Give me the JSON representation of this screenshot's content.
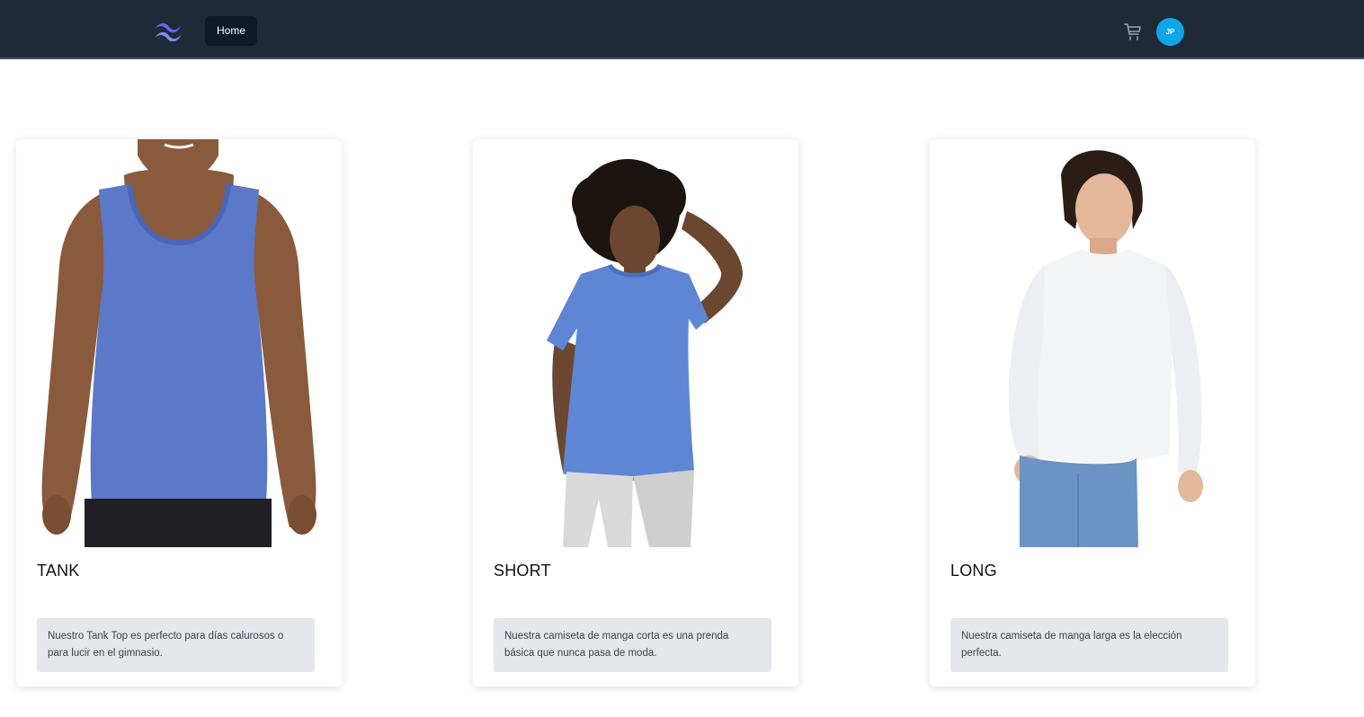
{
  "navbar": {
    "logo_icon": "tailwind-logo-icon",
    "home_label": "Home",
    "cart_icon": "cart-icon",
    "avatar_initials": "JP",
    "background_color": "#1f2937",
    "accent_color": "#0ea5e9"
  },
  "products": [
    {
      "title": "TANK",
      "description": "Nuestro Tank Top es perfecto para días calurosos o para lucir en el gimnasio.",
      "image": "man-in-blue-tank-top"
    },
    {
      "title": "SHORT",
      "description": "Nuestra camiseta de manga corta es una prenda básica que nunca pasa de moda.",
      "image": "woman-in-blue-short-sleeve-tshirt"
    },
    {
      "title": "LONG",
      "description": "Nuestra camiseta de manga larga es la elección perfecta.",
      "image": "man-in-white-long-sleeve-shirt"
    }
  ]
}
